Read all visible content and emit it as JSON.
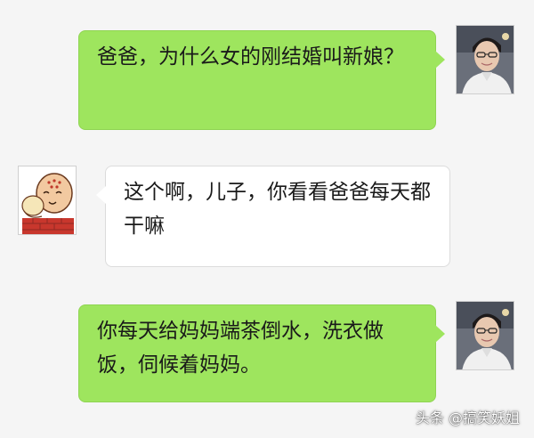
{
  "conversation": {
    "messages": [
      {
        "sender": "self",
        "avatar": "user-photo-avatar-icon",
        "text": "爸爸，为什么女的刚结婚叫新娘？"
      },
      {
        "sender": "other",
        "avatar": "cartoon-elder-avatar-icon",
        "text": "这个啊，儿子，你看看爸爸每天都干嘛"
      },
      {
        "sender": "self",
        "avatar": "user-photo-avatar-icon",
        "text": "你每天给妈妈端茶倒水，洗衣做饭，伺候着妈妈。"
      }
    ]
  },
  "watermark": {
    "text": "头条 @搞笑妖姐"
  },
  "colors": {
    "background": "#f5f5f5",
    "sent_bubble": "#9ee55e",
    "received_bubble": "#ffffff",
    "text": "#1a1a1a"
  }
}
